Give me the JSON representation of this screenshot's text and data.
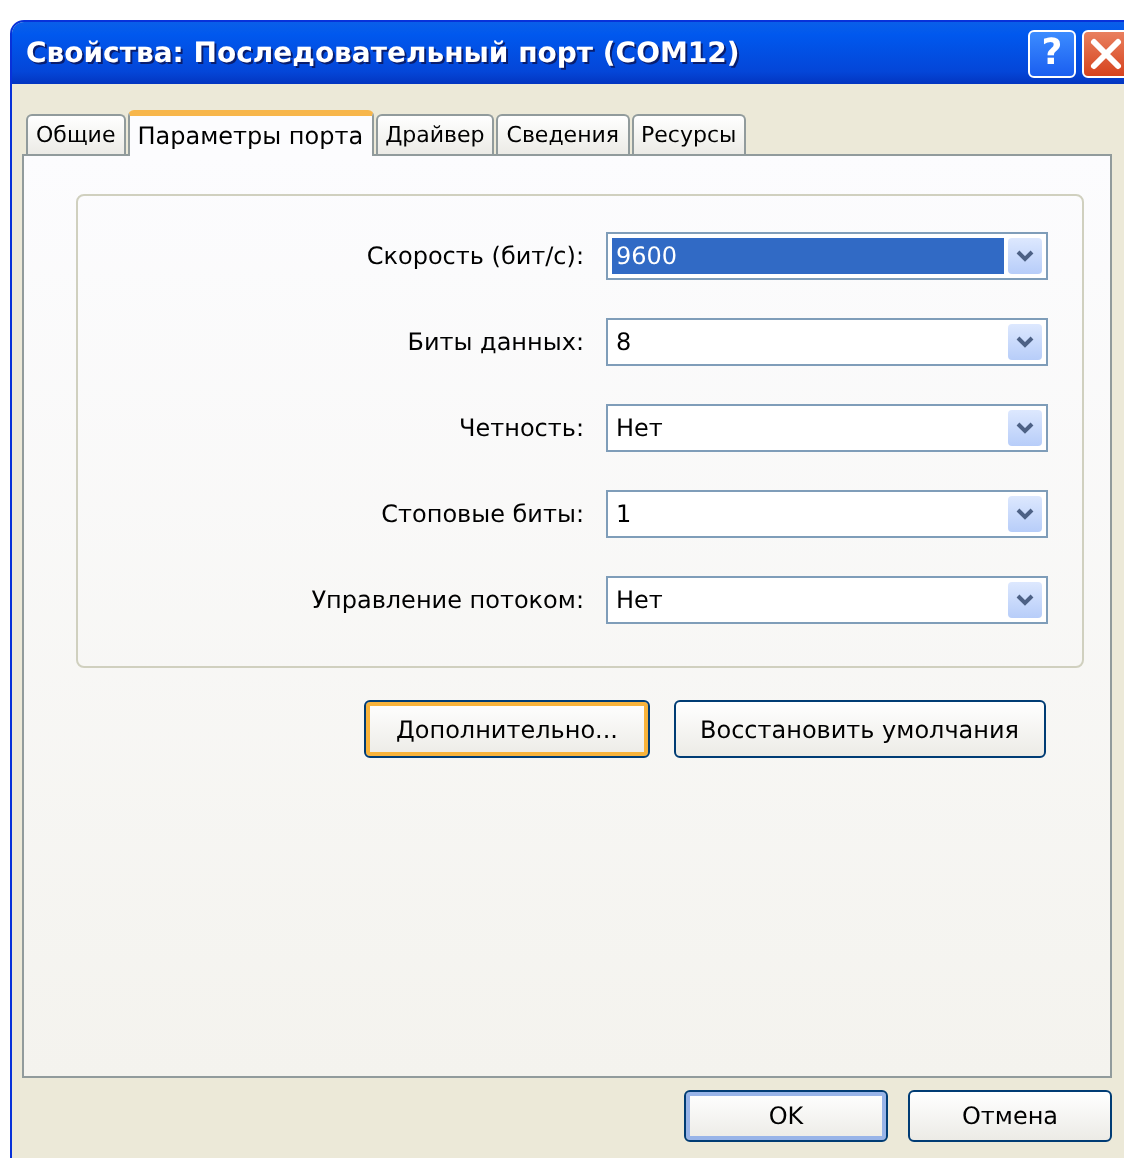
{
  "window": {
    "title": "Свойства: Последовательный порт (COM12)",
    "help": "?"
  },
  "tabs": [
    {
      "label": "Общие",
      "selected": false
    },
    {
      "label": "Параметры порта",
      "selected": true
    },
    {
      "label": "Драйвер",
      "selected": false
    },
    {
      "label": "Сведения",
      "selected": false
    },
    {
      "label": "Ресурсы",
      "selected": false
    }
  ],
  "settings": [
    {
      "label": "Скорость (бит/с):",
      "value": "9600",
      "focused": true
    },
    {
      "label": "Биты данных:",
      "value": "8",
      "focused": false
    },
    {
      "label": "Четность:",
      "value": "Нет",
      "focused": false
    },
    {
      "label": "Стоповые биты:",
      "value": "1",
      "focused": false
    },
    {
      "label": "Управление потоком:",
      "value": "Нет",
      "focused": false
    }
  ],
  "actions": [
    {
      "label": "Дополнительно...",
      "default": true
    },
    {
      "label": "Восстановить умолчания",
      "default": false
    }
  ],
  "buttons": [
    {
      "label": "OK",
      "default": true
    },
    {
      "label": "Отмена",
      "default": false
    }
  ]
}
